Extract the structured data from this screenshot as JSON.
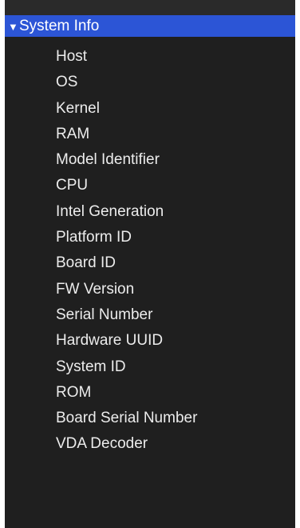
{
  "section": {
    "title": "System Info",
    "expanded_glyph": "▼",
    "items": [
      {
        "label": "Host"
      },
      {
        "label": "OS"
      },
      {
        "label": "Kernel"
      },
      {
        "label": "RAM"
      },
      {
        "label": "Model Identifier"
      },
      {
        "label": "CPU"
      },
      {
        "label": "Intel Generation"
      },
      {
        "label": "Platform ID"
      },
      {
        "label": "Board ID"
      },
      {
        "label": "FW Version"
      },
      {
        "label": "Serial Number"
      },
      {
        "label": "Hardware UUID"
      },
      {
        "label": "System ID"
      },
      {
        "label": "ROM"
      },
      {
        "label": "Board Serial Number"
      },
      {
        "label": "VDA Decoder"
      }
    ]
  },
  "colors": {
    "panel_bg": "#1f1f1f",
    "header_bg": "#2c55d6",
    "text": "#ececec"
  }
}
